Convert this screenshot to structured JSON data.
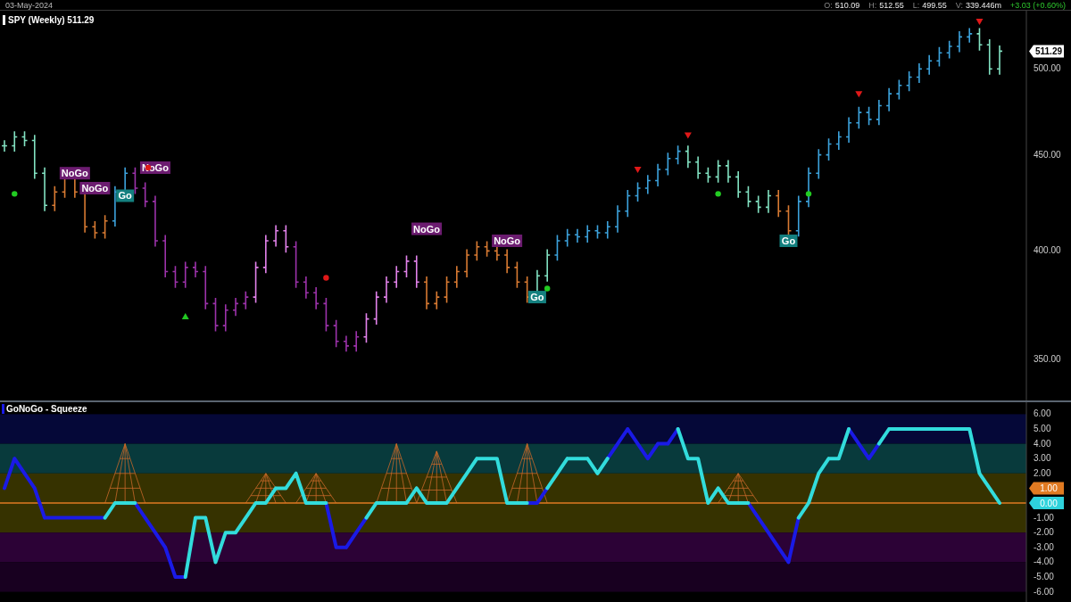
{
  "header": {
    "date": "03-May-2024",
    "ohlc": [
      {
        "label": "O:",
        "value": "510.09"
      },
      {
        "label": "H:",
        "value": "512.55"
      },
      {
        "label": "L:",
        "value": "499.55"
      },
      {
        "label": "V:",
        "value": "339.446m"
      }
    ],
    "change": "+3.03 (+0.60%)"
  },
  "price_chart": {
    "title": "SPY (Weekly) 511.29",
    "price_badge": "511.29",
    "axis_labels": [
      "500.00",
      "450.00",
      "400.00",
      "350.00"
    ],
    "tags": [
      {
        "kind": "nogo",
        "text": "NoGo"
      },
      {
        "kind": "nogo",
        "text": "NoGo"
      },
      {
        "kind": "go",
        "text": "Go"
      },
      {
        "kind": "nogo",
        "text": "NoGo"
      },
      {
        "kind": "nogo",
        "text": "NoGo"
      },
      {
        "kind": "nogo",
        "text": "NoGo"
      },
      {
        "kind": "go",
        "text": "Go"
      },
      {
        "kind": "go",
        "text": "Go"
      }
    ]
  },
  "oscillator_panel": {
    "title": "GoNoGo - Squeeze",
    "axis_labels": [
      "6.00",
      "5.00",
      "4.00",
      "3.00",
      "2.00",
      "-1.00",
      "-2.00",
      "-3.00",
      "-4.00",
      "-5.00",
      "-6.00"
    ],
    "badges": [
      {
        "kind": "signal",
        "text": "1.00"
      },
      {
        "kind": "oscillator",
        "text": "0.00"
      }
    ]
  }
}
